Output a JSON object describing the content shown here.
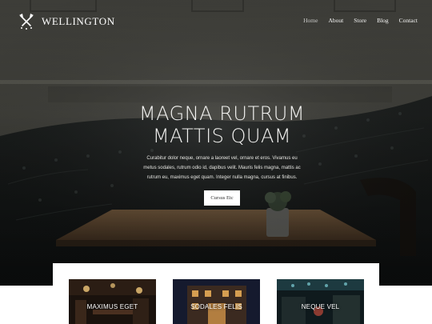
{
  "brand": {
    "name": "WELLINGTON",
    "icon": "crossed-axes-icon"
  },
  "nav": {
    "items": [
      {
        "label": "Home",
        "active": true
      },
      {
        "label": "About",
        "active": false
      },
      {
        "label": "Store",
        "active": false
      },
      {
        "label": "Blog",
        "active": false
      },
      {
        "label": "Contact",
        "active": false
      }
    ]
  },
  "hero": {
    "title_line1": "MAGNA RUTRUM",
    "title_line2": "MATTIS QUAM",
    "text": "Curabitur dolor neque, ornare a laoreet vel, ornare et eros. Vivamus eu metus sodales, rutrum odio id, dapibus velit. Mauris felis magna, mattis ac rutrum eu, maximus eget quam. Integer nulla magna, cursus at finibus.",
    "button_label": "Cursus Etc"
  },
  "cards": [
    {
      "label": "MAXIMUS EGET"
    },
    {
      "label": "SODALES FELIS"
    },
    {
      "label": "NEQUE VEL"
    }
  ],
  "colors": {
    "hero_overlay": "#2a2a26",
    "text": "#ffffff",
    "button_bg": "#ffffff"
  }
}
